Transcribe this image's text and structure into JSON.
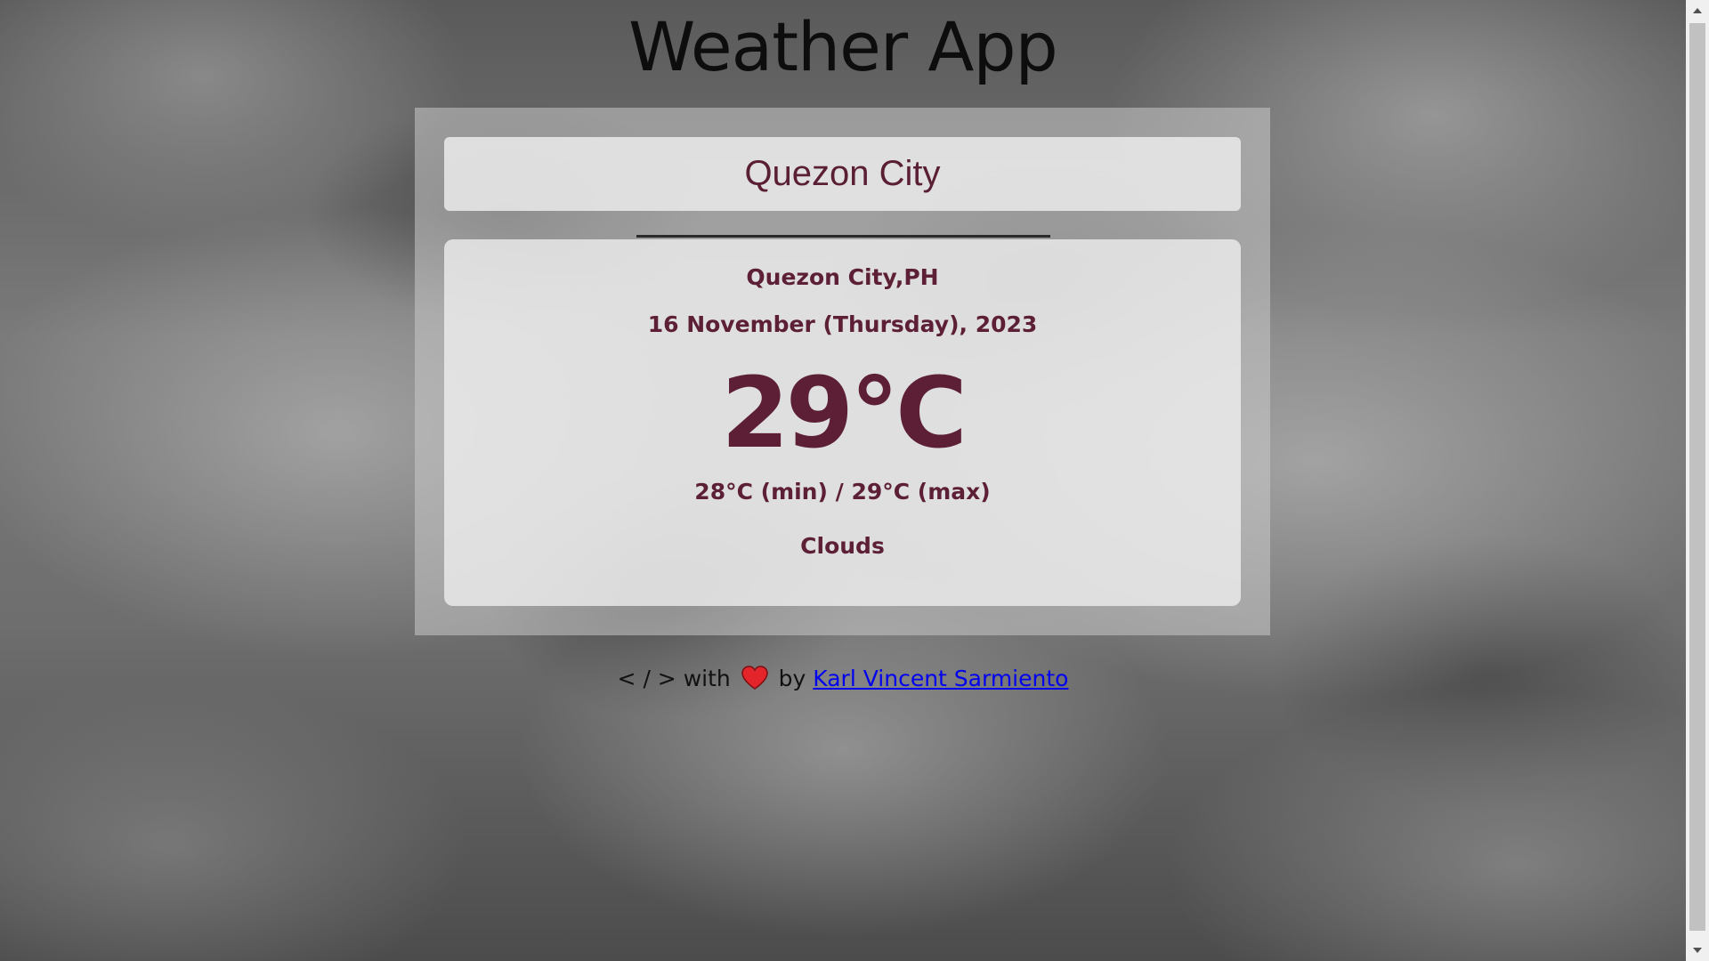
{
  "header": {
    "title": "Weather App"
  },
  "search": {
    "value": "Quezon City"
  },
  "weather": {
    "location": "Quezon City,PH",
    "date": "16 November (Thursday), 2023",
    "temperature": "29°C",
    "min_max": "28°C (min) / 29°C (max)",
    "condition": "Clouds"
  },
  "footer": {
    "prefix": "< / > with",
    "by": "by",
    "author_link": "Karl Vincent Sarmiento"
  },
  "icons": {
    "heart": "heart-icon",
    "scroll_up": "scroll-up-arrow-icon",
    "scroll_down": "scroll-down-arrow-icon"
  },
  "colors": {
    "accent_text": "#5c1f36",
    "link": "#0000ee",
    "heart": "#e3242b"
  }
}
